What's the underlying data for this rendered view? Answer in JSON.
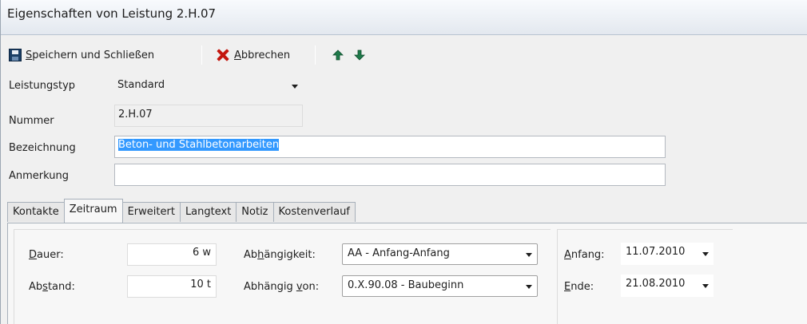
{
  "window": {
    "title": "Eigenschaften von Leistung 2.H.07"
  },
  "toolbar": {
    "save_label_u": "S",
    "save_label_rest": "peichern und Schließen",
    "cancel_label_u": "A",
    "cancel_label_rest": "bbrechen",
    "up_icon": "arrow-up-icon",
    "down_icon": "arrow-down-icon"
  },
  "form": {
    "leistungstyp": {
      "label": "Leistungstyp",
      "value": "Standard"
    },
    "nummer": {
      "label": "Nummer",
      "value": "2.H.07"
    },
    "bezeichnung": {
      "label": "Bezeichnung",
      "value": "Beton- und Stahlbetonarbeiten"
    },
    "anmerkung": {
      "label": "Anmerkung",
      "value": ""
    }
  },
  "tabs": [
    {
      "label": "Kontakte",
      "active": false
    },
    {
      "label": "Zeitraum",
      "active": true
    },
    {
      "label": "Erweitert",
      "active": false
    },
    {
      "label": "Langtext",
      "active": false
    },
    {
      "label": "Notiz",
      "active": false
    },
    {
      "label": "Kostenverlauf",
      "active": false
    }
  ],
  "zeitraum": {
    "dauer": {
      "label_u": "D",
      "label_rest": "auer:",
      "value": "6 w"
    },
    "abstand": {
      "label_pre": "Ab",
      "label_u": "s",
      "label_rest": "tand:",
      "value": "10 t"
    },
    "abhaengigkeit": {
      "label_pre": "Ab",
      "label_u": "h",
      "label_rest": "ängigkeit:",
      "value": "AA - Anfang-Anfang"
    },
    "abhaengig_von": {
      "label_pre": "Abhängig ",
      "label_u": "v",
      "label_rest": "on:",
      "value": "0.X.90.08 - Baubeginn"
    },
    "anfang": {
      "label_u": "A",
      "label_rest": "nfang:",
      "value": "11.07.2010"
    },
    "ende": {
      "label_u": "E",
      "label_rest": "nde:",
      "value": "21.08.2010"
    }
  },
  "colors": {
    "selection": "#3399ff",
    "cancel_icon": "#c4170f",
    "arrow_icon": "#1f7a4a"
  }
}
